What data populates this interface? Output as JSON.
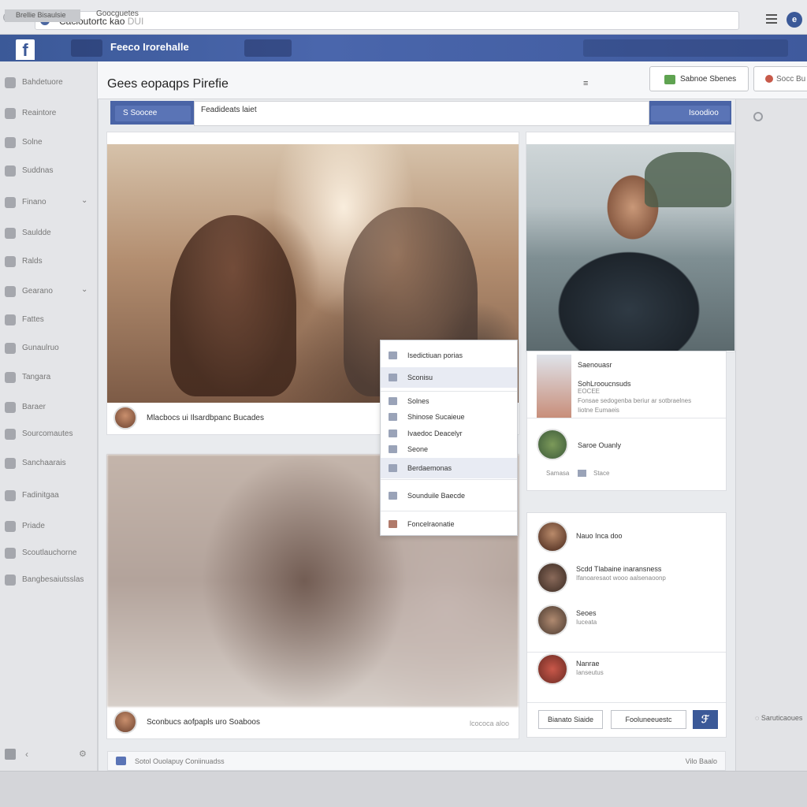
{
  "browser": {
    "address_text": "Cacioutortc kao",
    "address_suffix": "DUI"
  },
  "fb_bar": {
    "logo": "f",
    "title": "Feeco Irorehalle"
  },
  "sidebar": {
    "items": [
      {
        "label": "Bahdetuore"
      },
      {
        "label": "Reaintore"
      },
      {
        "label": "Solne"
      },
      {
        "label": "Suddnas"
      },
      {
        "label": "Finano",
        "chevron": "⌄"
      },
      {
        "label": "Sauldde"
      },
      {
        "label": "Ralds"
      },
      {
        "label": "Gearano",
        "chevron": "⌄"
      },
      {
        "label": "Fattes"
      },
      {
        "label": "Gunaulruo"
      },
      {
        "label": "Tangara"
      },
      {
        "label": "Baraer"
      },
      {
        "label": "Sourcomautes"
      },
      {
        "label": "Sanchaarais"
      },
      {
        "label": "Fadinitgaa"
      },
      {
        "label": "Priade"
      },
      {
        "label": "Scoutlauchorne"
      },
      {
        "label": "Bangbesaiutsslas"
      }
    ]
  },
  "header": {
    "title": "Gees eopaqps Pirefie",
    "menu": "≡",
    "save_button": "Sabnoe Sbenes",
    "search_button": "Socc Bu"
  },
  "content_bar": {
    "left_tab": "S   Soocee",
    "input_text": "Feadideats laiet",
    "right_tab": "Isoodioo"
  },
  "photo1": {
    "caption": "Mlacbocs ui Ilsardbpanc Bucades"
  },
  "photo2": {
    "caption": "Sconbucs aofpapls uro Soaboos",
    "meta": "lcococa aloo"
  },
  "dropdown": {
    "items": [
      {
        "label": "Isedictiuan porias"
      },
      {
        "label": "Sconisu"
      },
      {
        "label": "Solnes"
      },
      {
        "label": "Shinose Sucaieue"
      },
      {
        "label": "Ivaedoc Deacelyr"
      },
      {
        "label": "Seone"
      },
      {
        "label": "Berdaemonas"
      },
      {
        "label": "Sounduile Baecde"
      },
      {
        "label": "Foncelraonatie"
      }
    ]
  },
  "panel_a": {
    "header": "Saenouasr",
    "title": "SohLrooucnsuds",
    "sub1": "EOCEE",
    "sub2": "Fonsae sedogenba beriur ar sotbraelnes",
    "sub3": "Iiotne Eumaeis",
    "person": "Saroe Ouanly",
    "link1": "Samasa",
    "link2": "Stace"
  },
  "panel_b": {
    "items": [
      {
        "name": "Nauo Inca doo",
        "sub": ""
      },
      {
        "name": "Scdd Tlabaine inaransness",
        "sub": "Ifanoaresaot wooo aalsenaoonp"
      },
      {
        "name": "Seoes",
        "sub": "Iuceata"
      },
      {
        "name": "Nanrae",
        "sub": "Ianseutus"
      }
    ],
    "btn1": "Bianato Siaide",
    "btn2": "Fooluneeuestc",
    "btn3": "ℱ"
  },
  "right_col": {
    "text": "Saruticaoues"
  },
  "main_footer": {
    "text": "Sotol Ouolapuy Coniinuadss",
    "right": "Vilo  Baalo"
  },
  "status": {
    "left": "Brellie Bisaulsie",
    "text": "Goocguetes"
  }
}
